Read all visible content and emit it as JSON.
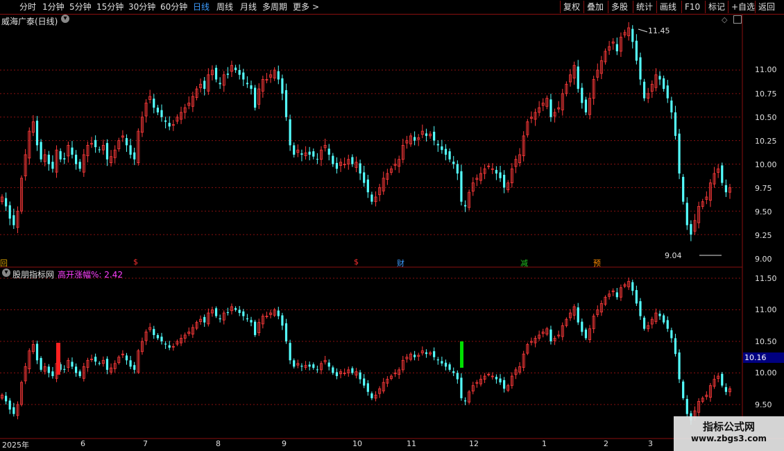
{
  "toolbar": {
    "periods": [
      {
        "label": "分时",
        "active": false
      },
      {
        "label": "1分钟",
        "active": false
      },
      {
        "label": "5分钟",
        "active": false
      },
      {
        "label": "15分钟",
        "active": false
      },
      {
        "label": "30分钟",
        "active": false
      },
      {
        "label": "60分钟",
        "active": false
      },
      {
        "label": "日线",
        "active": true
      },
      {
        "label": "周线",
        "active": false
      },
      {
        "label": "月线",
        "active": false
      },
      {
        "label": "多周期",
        "active": false
      },
      {
        "label": "更多",
        "active": false
      }
    ],
    "more_arrow": ">",
    "actions": [
      "复权",
      "叠加",
      "多股",
      "统计",
      "画线",
      "F10",
      "标记",
      "+自选",
      "返回"
    ]
  },
  "main_panel": {
    "title": "威海广泰(日线)",
    "high_label": "11.45",
    "low_label": "9.04",
    "price_ticks": [
      "11.00",
      "10.75",
      "10.50",
      "10.25",
      "10.00",
      "9.75",
      "9.50",
      "9.25",
      "9.00"
    ],
    "event_markers": [
      {
        "label": "回",
        "color": "#d8a000"
      },
      {
        "label": "$",
        "color": "#ff3030"
      },
      {
        "label": "$",
        "color": "#ff3030"
      },
      {
        "label": "财",
        "color": "#3c9cff"
      },
      {
        "label": "减",
        "color": "#20c020"
      },
      {
        "label": "预",
        "color": "#ff8c00"
      }
    ]
  },
  "sub_panel": {
    "title": "股朋指标网",
    "indicator_label": "高开涨幅%: 2.42",
    "price_ticks": [
      "11.50",
      "11.00",
      "10.50",
      "10.00",
      "9.50"
    ],
    "current_value": "10.16"
  },
  "time_axis": [
    "2025年",
    "6",
    "7",
    "8",
    "9",
    "10",
    "11",
    "12",
    "1",
    "2",
    "3"
  ],
  "watermark": {
    "title": "指标公式网",
    "url": "www.zbgs3.com"
  },
  "colors": {
    "up": "#ff3a3a",
    "down": "#54ffff",
    "grid": "#8a1010",
    "accent": "#3c9cff",
    "text": "#e0e0e0"
  },
  "chart_data": {
    "type": "candlestick",
    "x_axis_months": [
      "2025年",
      "6",
      "7",
      "8",
      "9",
      "10",
      "11",
      "12",
      "1",
      "2",
      "3"
    ],
    "main_ylim": [
      9.0,
      11.5
    ],
    "sub_ylim": [
      9.3,
      11.7
    ],
    "period_high": 11.45,
    "period_low": 9.04,
    "close_series": [
      9.65,
      9.55,
      9.42,
      9.35,
      9.5,
      9.85,
      10.1,
      10.35,
      10.45,
      10.2,
      10.05,
      10.1,
      10.0,
      9.95,
      10.15,
      10.05,
      10.05,
      10.2,
      10.1,
      10.0,
      9.95,
      10.1,
      10.2,
      10.22,
      10.18,
      10.15,
      10.2,
      10.05,
      10.08,
      10.15,
      10.25,
      10.3,
      10.2,
      10.1,
      10.05,
      10.35,
      10.5,
      10.65,
      10.72,
      10.6,
      10.55,
      10.5,
      10.45,
      10.4,
      10.42,
      10.5,
      10.55,
      10.6,
      10.65,
      10.72,
      10.8,
      10.85,
      10.8,
      10.95,
      11.0,
      10.9,
      10.85,
      10.95,
      10.95,
      11.05,
      11.0,
      10.95,
      10.9,
      10.85,
      10.8,
      10.6,
      10.8,
      10.9,
      10.9,
      10.95,
      11.0,
      10.9,
      10.75,
      10.5,
      10.2,
      10.1,
      10.15,
      10.1,
      10.12,
      10.1,
      10.08,
      10.05,
      10.15,
      10.2,
      10.1,
      10.0,
      9.95,
      10.02,
      10.0,
      10.05,
      10.0,
      10.02,
      9.9,
      9.8,
      9.7,
      9.6,
      9.65,
      9.75,
      9.85,
      9.9,
      9.95,
      10.0,
      10.05,
      10.2,
      10.25,
      10.3,
      10.25,
      10.28,
      10.35,
      10.3,
      10.32,
      10.25,
      10.2,
      10.15,
      10.1,
      10.05,
      10.0,
      9.9,
      9.6,
      9.55,
      9.7,
      9.8,
      9.85,
      9.9,
      9.95,
      9.98,
      9.95,
      9.9,
      9.85,
      9.75,
      9.8,
      9.95,
      10.05,
      10.1,
      10.3,
      10.45,
      10.5,
      10.55,
      10.6,
      10.65,
      10.7,
      10.5,
      10.55,
      10.6,
      10.75,
      10.85,
      10.95,
      11.05,
      10.8,
      10.65,
      10.55,
      10.7,
      10.9,
      11.0,
      11.1,
      11.2,
      11.25,
      11.3,
      11.2,
      11.35,
      11.4,
      11.45,
      11.3,
      11.1,
      10.9,
      10.7,
      10.75,
      10.85,
      10.95,
      10.9,
      10.8,
      10.7,
      10.55,
      10.3,
      9.9,
      9.6,
      9.35,
      9.25,
      9.4,
      9.55,
      9.6,
      9.65,
      9.8,
      9.9,
      9.95,
      9.8,
      9.7,
      9.75
    ]
  }
}
